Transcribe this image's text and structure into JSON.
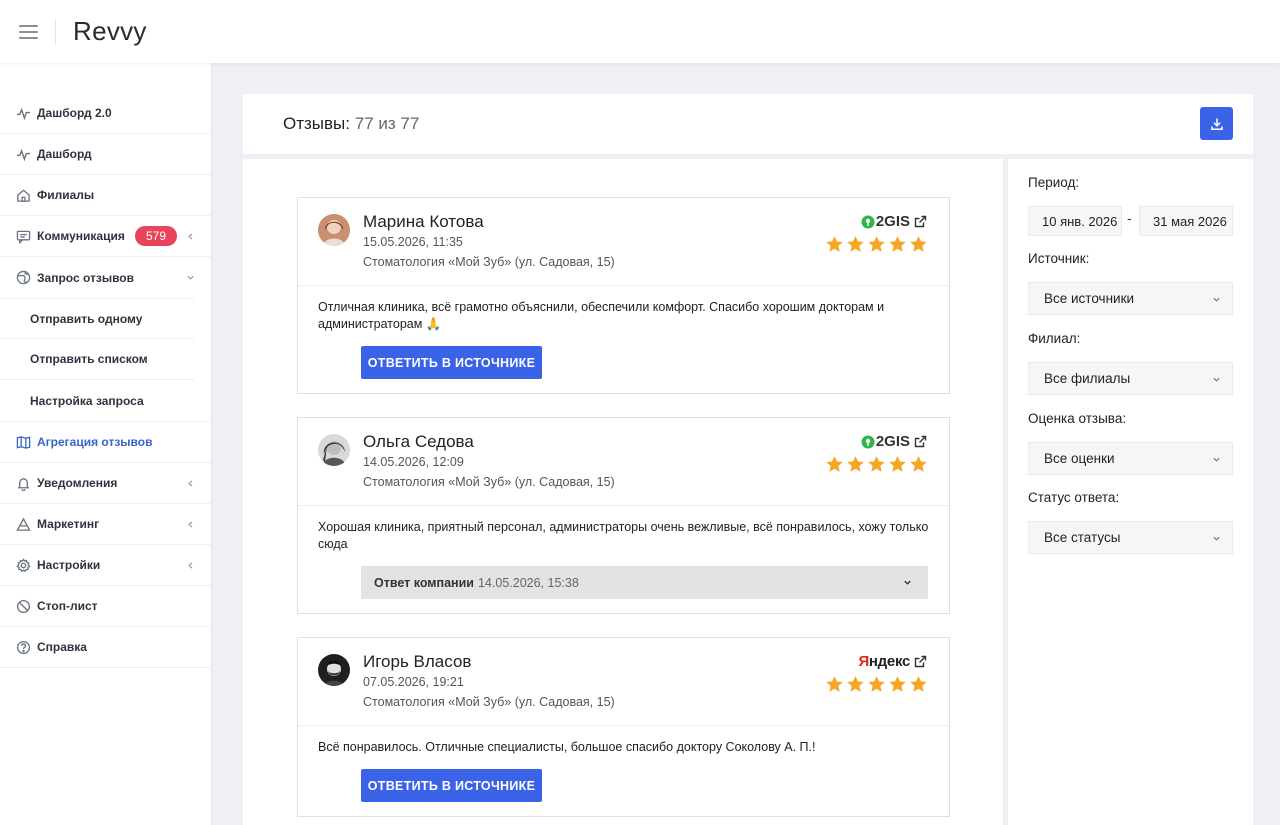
{
  "app": {
    "brand": "Revvy"
  },
  "sidebar": {
    "items": [
      {
        "label": "Дашборд 2.0"
      },
      {
        "label": "Дашборд"
      },
      {
        "label": "Филиалы"
      },
      {
        "label": "Коммуникация",
        "badge": "579"
      },
      {
        "label": "Запрос отзывов"
      },
      {
        "label": "Агрегация отзывов"
      },
      {
        "label": "Уведомления"
      },
      {
        "label": "Маркетинг"
      },
      {
        "label": "Настройки"
      },
      {
        "label": "Стоп-лист"
      },
      {
        "label": "Справка"
      }
    ],
    "subitems": [
      {
        "label": "Отправить одному"
      },
      {
        "label": "Отправить списком"
      },
      {
        "label": "Настройка запроса"
      }
    ]
  },
  "header": {
    "title": "Отзывы:",
    "count": "77 из 77"
  },
  "reviews": [
    {
      "name": "Марина Котова",
      "date": "15.05.2026, 11:35",
      "branch": "Стоматология «Мой Зуб» (ул. Садовая, 15)",
      "source": "2GIS",
      "rating": 5,
      "text": "Отличная клиника, всё грамотно объяснили, обеспечили комфорт. Спасибо хорошим докторам и администраторам 🙏",
      "action": "ОТВЕТИТЬ В ИСТОЧНИКЕ"
    },
    {
      "name": "Ольга Седова",
      "date": "14.05.2026, 12:09",
      "branch": "Стоматология «Мой Зуб» (ул. Садовая, 15)",
      "source": "2GIS",
      "rating": 5,
      "text": "Хорошая клиника, приятный персонал, администраторы очень вежливые, всё понравилось, хожу только сюда",
      "answer_label": "Ответ компании",
      "answer_date": "14.05.2026, 15:38"
    },
    {
      "name": "Игорь Власов",
      "date": "07.05.2026, 19:21",
      "branch": "Стоматология «Мой Зуб» (ул. Садовая, 15)",
      "source_ya": "Я",
      "source_rest": "ндекс",
      "rating": 5,
      "text": "Всё понравилось. Отличные специалисты, большое спасибо доктору Соколову А. П.!",
      "action": "ОТВЕТИТЬ В ИСТОЧНИКЕ"
    }
  ],
  "filters": {
    "period_label": "Период:",
    "date_from": "10 янв. 2026",
    "date_to": "31 мая 2026",
    "dash": "-",
    "source_label": "Источник:",
    "source_value": "Все источники",
    "branch_label": "Филиал:",
    "branch_value": "Все филиалы",
    "rating_label": "Оценка отзыва:",
    "rating_value": "Все оценки",
    "status_label": "Статус ответа:",
    "status_value": "Все статусы"
  },
  "colors": {
    "accent": "#3b63e8",
    "badge": "#e8445a",
    "star": "#f5a623",
    "active_nav": "#3a64c8"
  }
}
